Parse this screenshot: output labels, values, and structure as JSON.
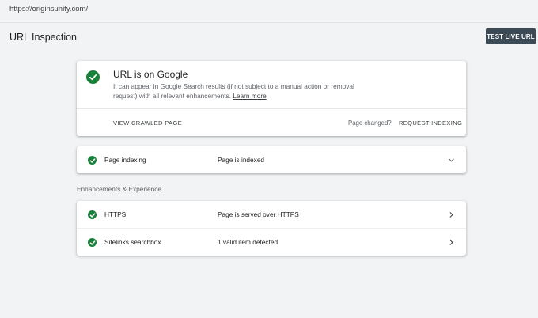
{
  "url_bar": {
    "url": "https://originsunity.com/"
  },
  "header": {
    "title": "URL Inspection",
    "test_live_label": "TEST LIVE URL"
  },
  "status": {
    "title": "URL is on Google",
    "description": "It can appear in Google Search results (if not subject to a manual action or removal request) with all relevant enhancements.",
    "learn_more": "Learn more",
    "view_crawled": "VIEW CRAWLED PAGE",
    "page_changed": "Page changed?",
    "request_indexing": "REQUEST INDEXING",
    "icon": "check-circle-icon",
    "status_color": "#188038"
  },
  "indexing": {
    "label": "Page indexing",
    "value": "Page is indexed",
    "icon": "chevron-down-icon"
  },
  "enhancements": {
    "heading": "Enhancements & Experience",
    "rows": [
      {
        "label": "HTTPS",
        "value": "Page is served over HTTPS",
        "icon": "chevron-right-icon"
      },
      {
        "label": "Sitelinks searchbox",
        "value": "1 valid item detected",
        "icon": "chevron-right-icon"
      }
    ]
  },
  "colors": {
    "background": "#f1f3f4",
    "button_bg": "#3c4a55",
    "success": "#188038"
  }
}
